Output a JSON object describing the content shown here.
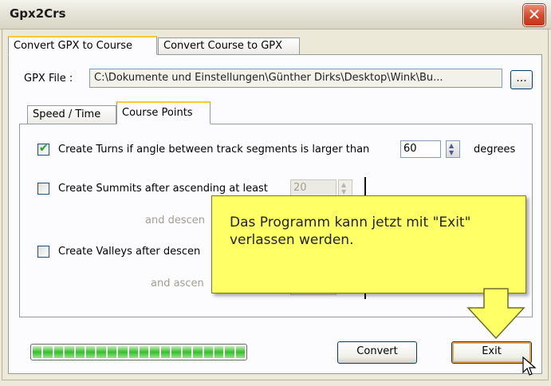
{
  "window": {
    "title": "Gpx2Crs",
    "close_symbol": "✕"
  },
  "tabs": [
    {
      "label": "Convert GPX to Course",
      "active": true
    },
    {
      "label": "Convert Course to GPX",
      "active": false
    }
  ],
  "gpx_file": {
    "label": "GPX File :",
    "value": "C:\\Dokumente und Einstellungen\\Günther Dirks\\Desktop\\Wink\\Bu...",
    "browse_label": "..."
  },
  "sub_tabs": [
    {
      "label": "Speed / Time",
      "active": false
    },
    {
      "label": "Course Points",
      "active": true
    }
  ],
  "course_points": {
    "turns": {
      "label": "Create Turns if angle between track segments is larger than",
      "checked": true,
      "value": "60",
      "unit": "degrees"
    },
    "summits": {
      "label": "Create Summits after ascending at least",
      "checked": false,
      "value": "20"
    },
    "summits_descend_label": "and descen",
    "valleys": {
      "label": "Create Valleys after descen",
      "checked": false
    },
    "valleys_ascend_label": "and ascen"
  },
  "callout": {
    "text": "Das Programm kann jetzt mit \"Exit\" verlassen werden."
  },
  "progress": {
    "value": 1.0
  },
  "buttons": {
    "convert": "Convert",
    "exit": "Exit"
  }
}
